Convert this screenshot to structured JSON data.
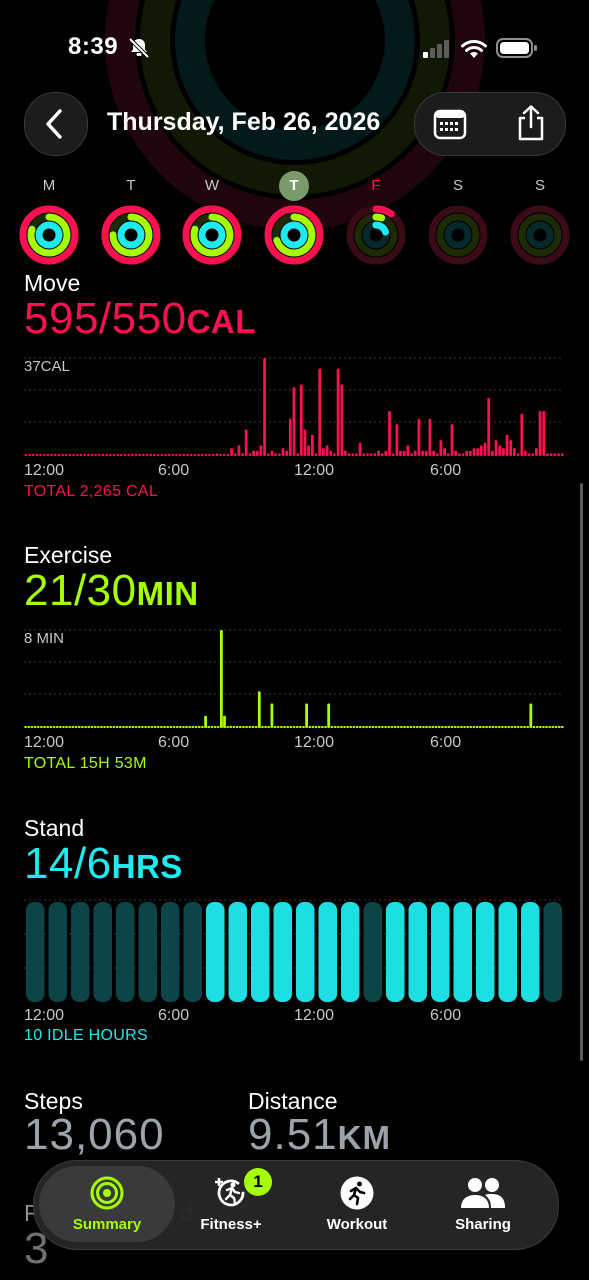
{
  "status_bar": {
    "time": "8:39"
  },
  "header": {
    "title": "Thursday, Feb 26, 2026"
  },
  "week": [
    {
      "label": "M",
      "move": 1,
      "exercise": 0.8,
      "stand": 1,
      "color": "#c7c7cc"
    },
    {
      "label": "T",
      "move": 1,
      "exercise": 0.75,
      "stand": 1,
      "color": "#c7c7cc"
    },
    {
      "label": "W",
      "move": 1,
      "exercise": 0.8,
      "stand": 1,
      "color": "#c7c7cc"
    },
    {
      "label": "T",
      "move": 1,
      "exercise": 0.7,
      "stand": 1,
      "color": "#e6ffe0",
      "selected": true
    },
    {
      "label": "F",
      "move": 0.1,
      "exercise": 0.05,
      "stand": 0.2,
      "color": "#fa114f"
    },
    {
      "label": "S",
      "move": 0,
      "exercise": 0,
      "stand": 0,
      "color": "#c7c7cc"
    },
    {
      "label": "S",
      "move": 0,
      "exercise": 0,
      "stand": 0,
      "color": "#c7c7cc"
    }
  ],
  "move": {
    "label": "Move",
    "value": "595/550",
    "unit": "CAL",
    "scale_label": "37CAL",
    "x_ticks": [
      "12:00",
      "6:00",
      "12:00",
      "6:00"
    ],
    "total": "TOTAL 2,265 CAL",
    "color": "#fa114f"
  },
  "exercise": {
    "label": "Exercise",
    "value": "21/30",
    "unit": "MIN",
    "scale_label": "8 MIN",
    "x_ticks": [
      "12:00",
      "6:00",
      "12:00",
      "6:00"
    ],
    "total": "TOTAL 15H 53M",
    "color": "#a6ff00"
  },
  "stand": {
    "label": "Stand",
    "value": "14/6",
    "unit": "HRS",
    "x_ticks": [
      "12:00",
      "6:00",
      "12:00",
      "6:00"
    ],
    "total": "10 IDLE HOURS",
    "color": "#1eeaef"
  },
  "stats": {
    "steps_label": "Steps",
    "steps_value": "13,060",
    "distance_label": "Distance",
    "distance_value": "9.51",
    "distance_unit": "KM",
    "partial_label": "F",
    "partial_label2": "d",
    "partial_value": "3"
  },
  "tabbar": {
    "items": [
      {
        "label": "Summary",
        "icon": "activity-rings-icon",
        "active": true
      },
      {
        "label": "Fitness+",
        "icon": "fitness-plus-icon",
        "badge": "1"
      },
      {
        "label": "Workout",
        "icon": "workout-runner-icon"
      },
      {
        "label": "Sharing",
        "icon": "sharing-people-icon"
      }
    ]
  },
  "chart_data": [
    {
      "type": "bar",
      "title": "Move",
      "series": [
        {
          "values": [
            0,
            0,
            0,
            0,
            0,
            0,
            0,
            0,
            0,
            0,
            0,
            0,
            0,
            0,
            0,
            0,
            0,
            0,
            0,
            0,
            0,
            0,
            0,
            0,
            0,
            0,
            0,
            0,
            0,
            0,
            0,
            0,
            0,
            0,
            0,
            0,
            0,
            0,
            0,
            0,
            0,
            0,
            0,
            0,
            0,
            0,
            0,
            0,
            0,
            0,
            0,
            0,
            1,
            0,
            0,
            0,
            3,
            1,
            4,
            1,
            10,
            1,
            2,
            2,
            4,
            37,
            1,
            2,
            1,
            1,
            3,
            2,
            14,
            26,
            1,
            27,
            10,
            4,
            8,
            1,
            33,
            3,
            4,
            2,
            1,
            33,
            27,
            2,
            1,
            1,
            1,
            5,
            1,
            1,
            1,
            1,
            2,
            1,
            2,
            17,
            1,
            12,
            2,
            2,
            4,
            1,
            2,
            14,
            2,
            2,
            14,
            2,
            1,
            6,
            3,
            1,
            12,
            2,
            1,
            1,
            2,
            2,
            3,
            3,
            4,
            5,
            22,
            2,
            6,
            4,
            3,
            8,
            6,
            3,
            1,
            16,
            2,
            1,
            1,
            3,
            17,
            17,
            1,
            1,
            1,
            1,
            1
          ]
        }
      ],
      "ylim": [
        0,
        37
      ],
      "x_ticks": [
        "12:00",
        "6:00",
        "12:00",
        "6:00"
      ]
    },
    {
      "type": "bar",
      "title": "Exercise",
      "series": [
        {
          "values": [
            0,
            0,
            0,
            0,
            0,
            0,
            0,
            0,
            0,
            0,
            0,
            0,
            0,
            0,
            0,
            0,
            0,
            0,
            0,
            0,
            0,
            0,
            0,
            0,
            0,
            0,
            0,
            0,
            0,
            0,
            0,
            0,
            0,
            0,
            0,
            0,
            0,
            0,
            0,
            0,
            0,
            0,
            0,
            0,
            0,
            0,
            0,
            0,
            0,
            0,
            0,
            0,
            0,
            0,
            0,
            0,
            0,
            1,
            0,
            0,
            0,
            0,
            8,
            1,
            0,
            0,
            0,
            0,
            0,
            0,
            0,
            0,
            0,
            0,
            3,
            0,
            0,
            0,
            2,
            0,
            0,
            0,
            0,
            0,
            0,
            0,
            0,
            0,
            0,
            2,
            0,
            0,
            0,
            0,
            0,
            0,
            2,
            0,
            0,
            0,
            0,
            0,
            0,
            0,
            0,
            0,
            0,
            0,
            0,
            0,
            0,
            0,
            0,
            0,
            0,
            0,
            0,
            0,
            0,
            0,
            0,
            0,
            0,
            0,
            0,
            0,
            0,
            0,
            0,
            0,
            0,
            0,
            0,
            0,
            0,
            0,
            0,
            0,
            0,
            0,
            0,
            0,
            0,
            0,
            0,
            0,
            0,
            0,
            0,
            0,
            0,
            0,
            0,
            0,
            0,
            0,
            0,
            0,
            0,
            0,
            2,
            0,
            0,
            0,
            0,
            0,
            0,
            0,
            0,
            0,
            0
          ]
        }
      ],
      "ylim": [
        0,
        8
      ],
      "x_ticks": [
        "12:00",
        "6:00",
        "12:00",
        "6:00"
      ]
    },
    {
      "type": "bar",
      "title": "Stand",
      "series": [
        {
          "values": [
            0,
            0,
            0,
            0,
            0,
            0,
            0,
            0,
            1,
            1,
            1,
            1,
            1,
            1,
            1,
            0,
            1,
            1,
            1,
            1,
            1,
            1,
            1,
            0
          ]
        }
      ],
      "x_ticks": [
        "12:00",
        "6:00",
        "12:00",
        "6:00"
      ]
    }
  ]
}
